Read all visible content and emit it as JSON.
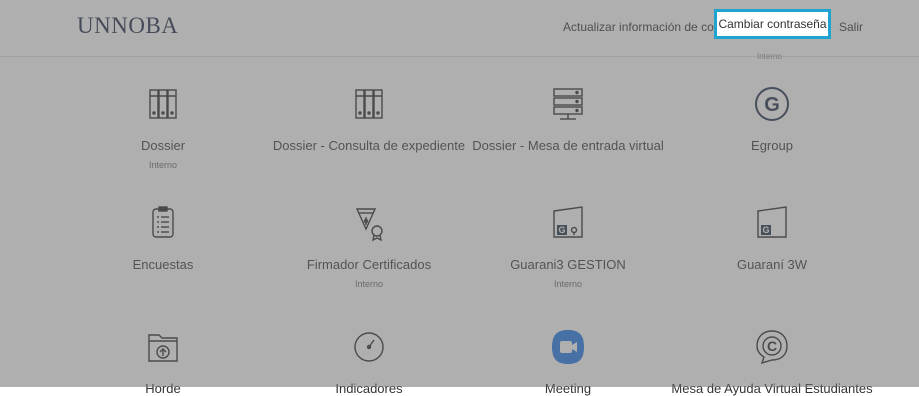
{
  "header": {
    "brand": "UNNOBA",
    "nav": {
      "contact": "Actualizar información de contacto",
      "password": "Cambiar contraseña",
      "exit": "Salir"
    },
    "underlabel": "Interno"
  },
  "tiles": [
    {
      "title": "Dossier",
      "sub": "Interno",
      "icon": "binders-icon"
    },
    {
      "title": "Dossier - Consulta de expediente",
      "sub": "",
      "icon": "binders-icon"
    },
    {
      "title": "Dossier - Mesa de entrada virtual",
      "sub": "",
      "icon": "server-icon"
    },
    {
      "title": "Egroup",
      "sub": "",
      "icon": "egroup-logo-icon"
    },
    {
      "title": "Encuestas",
      "sub": "",
      "icon": "clipboard-list-icon"
    },
    {
      "title": "Firmador Certificados",
      "sub": "Interno",
      "icon": "pen-nib-certificate-icon"
    },
    {
      "title": "Guarani3 GESTION",
      "sub": "Interno",
      "icon": "guarani-gestion-icon"
    },
    {
      "title": "Guaraní 3W",
      "sub": "",
      "icon": "guarani-web-icon"
    },
    {
      "title": "Horde",
      "sub": "",
      "icon": "folder-upload-icon"
    },
    {
      "title": "Indicadores",
      "sub": "",
      "icon": "gauge-icon"
    },
    {
      "title": "Meeting",
      "sub": "",
      "icon": "video-camera-icon"
    },
    {
      "title": "Mesa de Ayuda Virtual Estudiantes",
      "sub": "",
      "icon": "help-chat-icon"
    }
  ],
  "colors": {
    "overlay": "#6e6e6e",
    "highlight_border": "#1fa3d1",
    "brand": "#14233f",
    "meeting": "#1a73e8"
  }
}
